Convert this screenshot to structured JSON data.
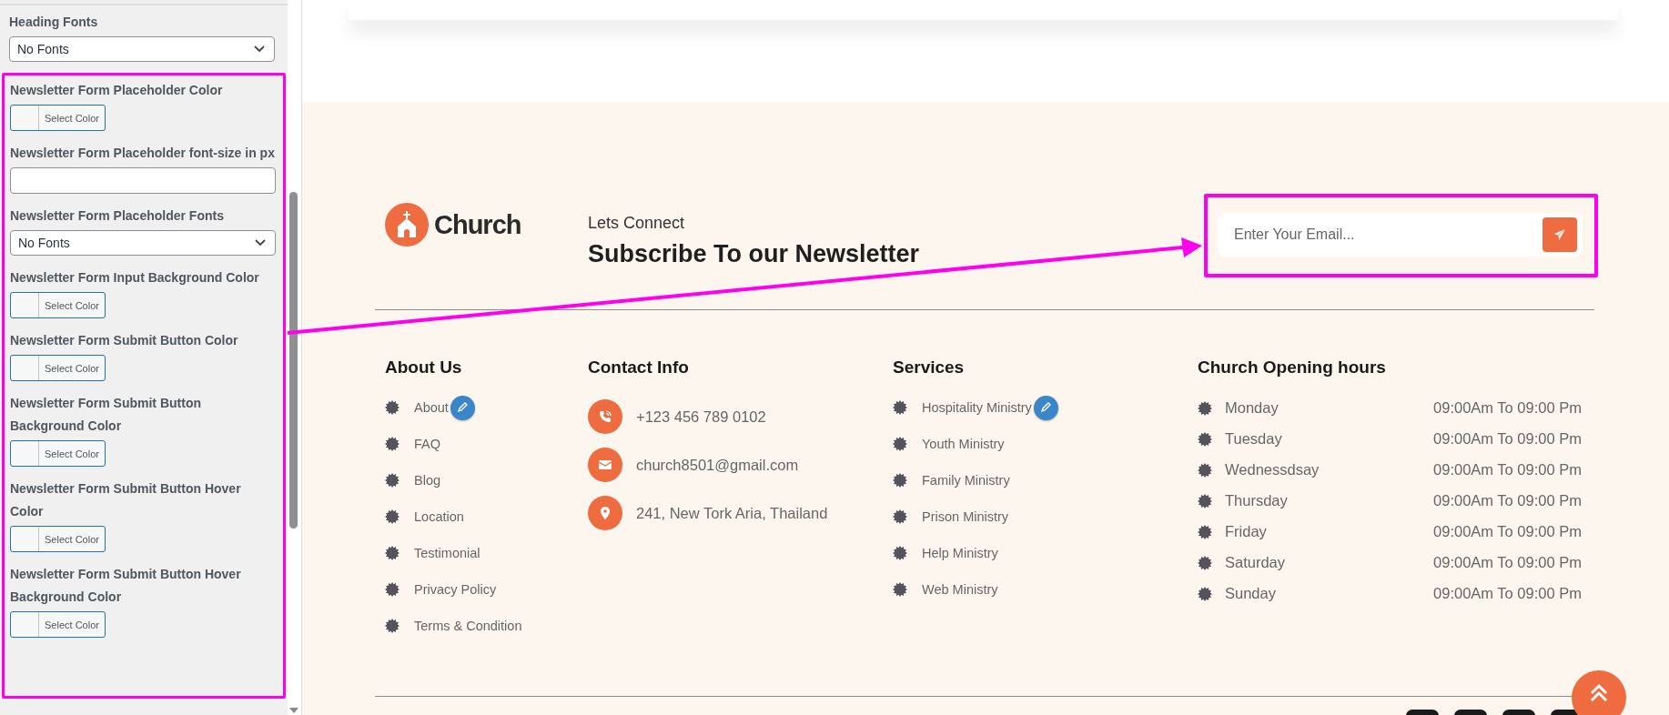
{
  "settings_panel": {
    "fields": [
      {
        "kind": "select",
        "label": "Heading Fonts",
        "value": "No Fonts"
      }
    ],
    "highlighted_fields": [
      {
        "kind": "color",
        "label": "Newsletter Form Placeholder Color",
        "button": "Select Color"
      },
      {
        "kind": "text",
        "label": "Newsletter Form Placeholder font-size in px"
      },
      {
        "kind": "select",
        "label": "Newsletter Form Placeholder Fonts",
        "value": "No Fonts"
      },
      {
        "kind": "color",
        "label": "Newsletter Form Input Background Color",
        "button": "Select Color"
      },
      {
        "kind": "color",
        "label": "Newsletter Form Submit Button Color",
        "button": "Select Color"
      },
      {
        "kind": "color",
        "label": "Newsletter Form Submit Button Background Color",
        "button": "Select Color"
      },
      {
        "kind": "color",
        "label": "Newsletter Form Submit Button Hover Color",
        "button": "Select Color"
      },
      {
        "kind": "color",
        "label": "Newsletter Form Submit Button Hover Background Color",
        "button": "Select Color"
      }
    ]
  },
  "newsletter": {
    "logo": "Church",
    "eyebrow": "Lets Connect",
    "title": "Subscribe To our Newsletter",
    "email_placeholder": "Enter Your Email..."
  },
  "about": {
    "title": "About Us",
    "links": [
      {
        "label": "About",
        "edit_badge": true
      },
      {
        "label": "FAQ",
        "edit_badge": false
      },
      {
        "label": "Blog",
        "edit_badge": false
      },
      {
        "label": "Location",
        "edit_badge": false
      },
      {
        "label": "Testimonial",
        "edit_badge": false
      },
      {
        "label": "Privacy Policy",
        "edit_badge": false
      },
      {
        "label": "Terms & Condition",
        "edit_badge": false
      }
    ]
  },
  "contact": {
    "title": "Contact Info",
    "items": [
      {
        "kind": "phone",
        "text": "+123 456 789 0102"
      },
      {
        "kind": "email",
        "text": "church8501@gmail.com"
      },
      {
        "kind": "location",
        "text": "241, New Tork Aria, Thailand"
      }
    ]
  },
  "services": {
    "title": "Services",
    "links": [
      {
        "label": "Hospitality Ministry",
        "edit_badge": true
      },
      {
        "label": "Youth Ministry",
        "edit_badge": false
      },
      {
        "label": "Family Ministry",
        "edit_badge": false
      },
      {
        "label": "Prison Ministry",
        "edit_badge": false
      },
      {
        "label": "Help Ministry",
        "edit_badge": false
      },
      {
        "label": "Web Ministry",
        "edit_badge": false
      }
    ]
  },
  "hours": {
    "title": "Church Opening hours",
    "rows": [
      {
        "day": "Monday",
        "time": "09:00Am To 09:00 Pm"
      },
      {
        "day": "Tuesday",
        "time": "09:00Am To 09:00 Pm"
      },
      {
        "day": "Wednessdsay",
        "time": "09:00Am To 09:00 Pm"
      },
      {
        "day": "Thursday",
        "time": "09:00Am To 09:00 Pm"
      },
      {
        "day": "Friday",
        "time": "09:00Am To 09:00 Pm"
      },
      {
        "day": "Saturday",
        "time": "09:00Am To 09:00 Pm"
      },
      {
        "day": "Sunday",
        "time": "09:00Am To 09:00 Pm"
      }
    ]
  }
}
